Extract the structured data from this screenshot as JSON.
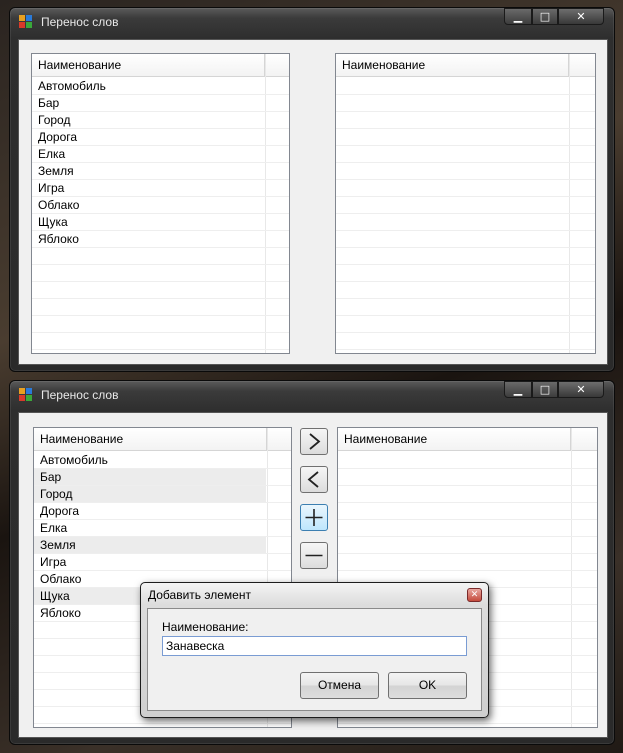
{
  "window1": {
    "title": "Перенос слов",
    "controls": {
      "minimize": "▁",
      "maximize": "□",
      "close": "✕"
    },
    "left_list": {
      "header": "Наименование",
      "items": [
        "Автомобиль",
        "Бар",
        "Город",
        "Дорога",
        "Елка",
        "Земля",
        "Игра",
        "Облако",
        "Щука",
        "Яблоко"
      ]
    },
    "right_list": {
      "header": "Наименование",
      "items": []
    }
  },
  "window2": {
    "title": "Перенос слов",
    "controls": {
      "minimize": "▁",
      "maximize": "□",
      "close": "✕"
    },
    "left_list": {
      "header": "Наименование",
      "items": [
        "Автомобиль",
        "Бар",
        "Город",
        "Дорога",
        "Елка",
        "Земля",
        "Игра",
        "Облако",
        "Щука",
        "Яблоко"
      ],
      "highlighted": [
        "Бар",
        "Город",
        "Земля",
        "Щука"
      ]
    },
    "right_list": {
      "header": "Наименование",
      "items": []
    },
    "action_buttons": [
      "move-right-icon",
      "move-left-icon",
      "add-icon",
      "remove-icon"
    ]
  },
  "dialog": {
    "title": "Добавить элемент",
    "close": "✕",
    "label": "Наименование:",
    "input_value": "Занавеска",
    "cancel_label": "Отмена",
    "ok_label": "OK"
  },
  "colors": {
    "titlebar_dark": "#2e2e2e",
    "client_bg": "#f0f0f0",
    "active_button": "#bee6fd",
    "close_red": "#c44a3c"
  }
}
